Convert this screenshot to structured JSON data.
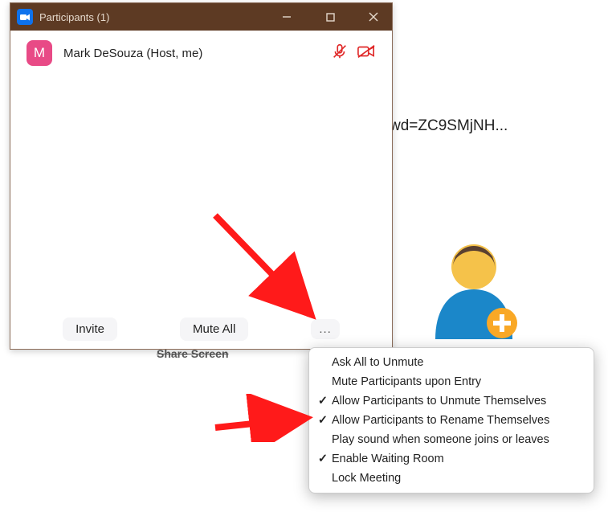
{
  "background": {
    "partial_url_text": "wd=ZC9SMjNH..."
  },
  "window": {
    "title": "Participants (1)"
  },
  "participant": {
    "initial": "M",
    "name": "Mark DeSouza (Host, me)"
  },
  "buttons": {
    "invite": "Invite",
    "mute_all": "Mute All",
    "more": "..."
  },
  "share_fragment": "Share Screen",
  "menu": {
    "items": [
      {
        "label": "Ask All to Unmute",
        "checked": false
      },
      {
        "label": "Mute Participants upon Entry",
        "checked": false
      },
      {
        "label": "Allow Participants to Unmute Themselves",
        "checked": true
      },
      {
        "label": "Allow Participants to Rename Themselves",
        "checked": true
      },
      {
        "label": "Play sound when someone joins or leaves",
        "checked": false
      },
      {
        "label": "Enable Waiting Room",
        "checked": true
      },
      {
        "label": "Lock Meeting",
        "checked": false
      }
    ]
  }
}
